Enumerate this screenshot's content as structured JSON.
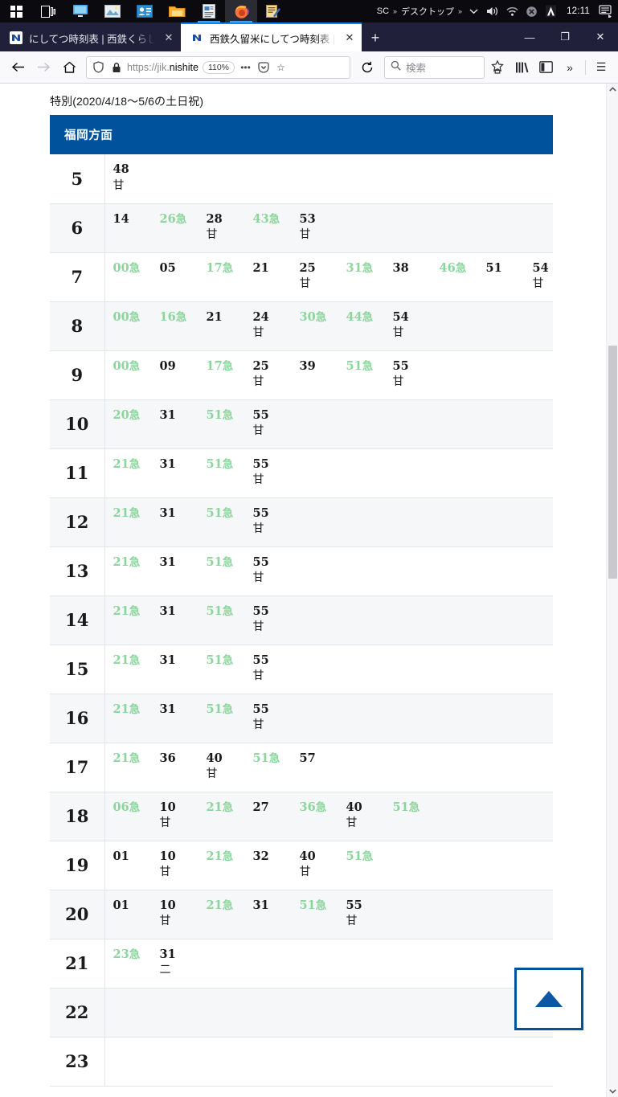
{
  "taskbar": {
    "icons": [
      {
        "name": "windows-start-icon",
        "glyph": "start"
      },
      {
        "name": "task-view-icon",
        "glyph": "taskview"
      },
      {
        "name": "remote-desktop-icon",
        "glyph": "monitor"
      },
      {
        "name": "photos-icon",
        "glyph": "photo"
      },
      {
        "name": "contacts-icon",
        "glyph": "contact"
      },
      {
        "name": "file-explorer-icon",
        "glyph": "folder"
      },
      {
        "name": "text-editor-icon",
        "glyph": "doc"
      },
      {
        "name": "firefox-icon",
        "glyph": "firefox"
      },
      {
        "name": "notepad-editor-icon",
        "glyph": "editor"
      }
    ],
    "ime_label": "SC",
    "ime_chevron": "»",
    "desktop_label": "デスクトップ",
    "desktop_chevron": "»",
    "show_hidden": "∨",
    "volume_icon": "🔊",
    "network_icon": "network-icon",
    "block_icon": "⊗",
    "app_icon": "A",
    "clock": "12:11",
    "notification_icon": "notification-icon"
  },
  "browser": {
    "tabs": [
      {
        "favicon": "N",
        "title": "にしてつ時刻表 | 西鉄くらしネット",
        "close": "✕",
        "active": false
      },
      {
        "favicon": "N",
        "title": "西鉄久留米にしてつ時刻表 | 西鉄",
        "close": "✕",
        "active": true
      }
    ],
    "new_tab_label": "+",
    "window_controls": {
      "minimize": "—",
      "maximize": "❐",
      "close": "✕"
    },
    "nav": {
      "back": "←",
      "forward": "→",
      "home": "⌂",
      "reload": "↻"
    },
    "url": {
      "shield_icon": "shield-icon",
      "lock_icon": "🔒",
      "protocol": "https://jik.",
      "domain": "nishite",
      "zoom_level": "110%",
      "page_actions": "•••",
      "pocket_icon": "pocket-icon",
      "bookmark_icon": "☆"
    },
    "search": {
      "icon": "search-icon",
      "placeholder": "検索",
      "value": ""
    },
    "toolbar_right": {
      "screenshot": "screenshot-icon",
      "library": "library-icon",
      "sidebar": "sidebar-icon",
      "overflow": "»",
      "menu": "☰"
    }
  },
  "page": {
    "caption": "特別(2020/4/18〜5/6の土日祝)",
    "table_header": "福岡方面",
    "scroll_top_button": "scroll-to-top",
    "rows": [
      {
        "hour": "5",
        "slots": [
          {
            "m": "48",
            "sfx": "",
            "sub": "甘",
            "exp": false
          }
        ]
      },
      {
        "hour": "6",
        "slots": [
          {
            "m": "14",
            "sfx": "",
            "sub": "",
            "exp": false
          },
          {
            "m": "26",
            "sfx": "急",
            "sub": "",
            "exp": true
          },
          {
            "m": "28",
            "sfx": "",
            "sub": "甘",
            "exp": false
          },
          {
            "m": "43",
            "sfx": "急",
            "sub": "",
            "exp": true
          },
          {
            "m": "53",
            "sfx": "",
            "sub": "甘",
            "exp": false
          }
        ]
      },
      {
        "hour": "7",
        "slots": [
          {
            "m": "00",
            "sfx": "急",
            "sub": "",
            "exp": true
          },
          {
            "m": "05",
            "sfx": "",
            "sub": "",
            "exp": false
          },
          {
            "m": "17",
            "sfx": "急",
            "sub": "",
            "exp": true
          },
          {
            "m": "21",
            "sfx": "",
            "sub": "",
            "exp": false
          },
          {
            "m": "25",
            "sfx": "",
            "sub": "甘",
            "exp": false
          },
          {
            "m": "31",
            "sfx": "急",
            "sub": "",
            "exp": true
          },
          {
            "m": "38",
            "sfx": "",
            "sub": "",
            "exp": false
          },
          {
            "m": "46",
            "sfx": "急",
            "sub": "",
            "exp": true
          },
          {
            "m": "51",
            "sfx": "",
            "sub": "",
            "exp": false
          },
          {
            "m": "54",
            "sfx": "",
            "sub": "甘",
            "exp": false
          }
        ]
      },
      {
        "hour": "8",
        "slots": [
          {
            "m": "00",
            "sfx": "急",
            "sub": "",
            "exp": true
          },
          {
            "m": "16",
            "sfx": "急",
            "sub": "",
            "exp": true
          },
          {
            "m": "21",
            "sfx": "",
            "sub": "",
            "exp": false
          },
          {
            "m": "24",
            "sfx": "",
            "sub": "甘",
            "exp": false
          },
          {
            "m": "30",
            "sfx": "急",
            "sub": "",
            "exp": true
          },
          {
            "m": "44",
            "sfx": "急",
            "sub": "",
            "exp": true
          },
          {
            "m": "54",
            "sfx": "",
            "sub": "甘",
            "exp": false
          }
        ]
      },
      {
        "hour": "9",
        "slots": [
          {
            "m": "00",
            "sfx": "急",
            "sub": "",
            "exp": true
          },
          {
            "m": "09",
            "sfx": "",
            "sub": "",
            "exp": false
          },
          {
            "m": "17",
            "sfx": "急",
            "sub": "",
            "exp": true
          },
          {
            "m": "25",
            "sfx": "",
            "sub": "甘",
            "exp": false
          },
          {
            "m": "39",
            "sfx": "",
            "sub": "",
            "exp": false
          },
          {
            "m": "51",
            "sfx": "急",
            "sub": "",
            "exp": true
          },
          {
            "m": "55",
            "sfx": "",
            "sub": "甘",
            "exp": false
          }
        ]
      },
      {
        "hour": "10",
        "slots": [
          {
            "m": "20",
            "sfx": "急",
            "sub": "",
            "exp": true
          },
          {
            "m": "31",
            "sfx": "",
            "sub": "",
            "exp": false
          },
          {
            "m": "51",
            "sfx": "急",
            "sub": "",
            "exp": true
          },
          {
            "m": "55",
            "sfx": "",
            "sub": "甘",
            "exp": false
          }
        ]
      },
      {
        "hour": "11",
        "slots": [
          {
            "m": "21",
            "sfx": "急",
            "sub": "",
            "exp": true
          },
          {
            "m": "31",
            "sfx": "",
            "sub": "",
            "exp": false
          },
          {
            "m": "51",
            "sfx": "急",
            "sub": "",
            "exp": true
          },
          {
            "m": "55",
            "sfx": "",
            "sub": "甘",
            "exp": false
          }
        ]
      },
      {
        "hour": "12",
        "slots": [
          {
            "m": "21",
            "sfx": "急",
            "sub": "",
            "exp": true
          },
          {
            "m": "31",
            "sfx": "",
            "sub": "",
            "exp": false
          },
          {
            "m": "51",
            "sfx": "急",
            "sub": "",
            "exp": true
          },
          {
            "m": "55",
            "sfx": "",
            "sub": "甘",
            "exp": false
          }
        ]
      },
      {
        "hour": "13",
        "slots": [
          {
            "m": "21",
            "sfx": "急",
            "sub": "",
            "exp": true
          },
          {
            "m": "31",
            "sfx": "",
            "sub": "",
            "exp": false
          },
          {
            "m": "51",
            "sfx": "急",
            "sub": "",
            "exp": true
          },
          {
            "m": "55",
            "sfx": "",
            "sub": "甘",
            "exp": false
          }
        ]
      },
      {
        "hour": "14",
        "slots": [
          {
            "m": "21",
            "sfx": "急",
            "sub": "",
            "exp": true
          },
          {
            "m": "31",
            "sfx": "",
            "sub": "",
            "exp": false
          },
          {
            "m": "51",
            "sfx": "急",
            "sub": "",
            "exp": true
          },
          {
            "m": "55",
            "sfx": "",
            "sub": "甘",
            "exp": false
          }
        ]
      },
      {
        "hour": "15",
        "slots": [
          {
            "m": "21",
            "sfx": "急",
            "sub": "",
            "exp": true
          },
          {
            "m": "31",
            "sfx": "",
            "sub": "",
            "exp": false
          },
          {
            "m": "51",
            "sfx": "急",
            "sub": "",
            "exp": true
          },
          {
            "m": "55",
            "sfx": "",
            "sub": "甘",
            "exp": false
          }
        ]
      },
      {
        "hour": "16",
        "slots": [
          {
            "m": "21",
            "sfx": "急",
            "sub": "",
            "exp": true
          },
          {
            "m": "31",
            "sfx": "",
            "sub": "",
            "exp": false
          },
          {
            "m": "51",
            "sfx": "急",
            "sub": "",
            "exp": true
          },
          {
            "m": "55",
            "sfx": "",
            "sub": "甘",
            "exp": false
          }
        ]
      },
      {
        "hour": "17",
        "slots": [
          {
            "m": "21",
            "sfx": "急",
            "sub": "",
            "exp": true
          },
          {
            "m": "36",
            "sfx": "",
            "sub": "",
            "exp": false
          },
          {
            "m": "40",
            "sfx": "",
            "sub": "甘",
            "exp": false
          },
          {
            "m": "51",
            "sfx": "急",
            "sub": "",
            "exp": true
          },
          {
            "m": "57",
            "sfx": "",
            "sub": "",
            "exp": false
          }
        ]
      },
      {
        "hour": "18",
        "slots": [
          {
            "m": "06",
            "sfx": "急",
            "sub": "",
            "exp": true
          },
          {
            "m": "10",
            "sfx": "",
            "sub": "甘",
            "exp": false
          },
          {
            "m": "21",
            "sfx": "急",
            "sub": "",
            "exp": true
          },
          {
            "m": "27",
            "sfx": "",
            "sub": "",
            "exp": false
          },
          {
            "m": "36",
            "sfx": "急",
            "sub": "",
            "exp": true
          },
          {
            "m": "40",
            "sfx": "",
            "sub": "甘",
            "exp": false
          },
          {
            "m": "51",
            "sfx": "急",
            "sub": "",
            "exp": true
          }
        ]
      },
      {
        "hour": "19",
        "slots": [
          {
            "m": "01",
            "sfx": "",
            "sub": "",
            "exp": false
          },
          {
            "m": "10",
            "sfx": "",
            "sub": "甘",
            "exp": false
          },
          {
            "m": "21",
            "sfx": "急",
            "sub": "",
            "exp": true
          },
          {
            "m": "32",
            "sfx": "",
            "sub": "",
            "exp": false
          },
          {
            "m": "40",
            "sfx": "",
            "sub": "甘",
            "exp": false
          },
          {
            "m": "51",
            "sfx": "急",
            "sub": "",
            "exp": true
          }
        ]
      },
      {
        "hour": "20",
        "slots": [
          {
            "m": "01",
            "sfx": "",
            "sub": "",
            "exp": false
          },
          {
            "m": "10",
            "sfx": "",
            "sub": "甘",
            "exp": false
          },
          {
            "m": "21",
            "sfx": "急",
            "sub": "",
            "exp": true
          },
          {
            "m": "31",
            "sfx": "",
            "sub": "",
            "exp": false
          },
          {
            "m": "51",
            "sfx": "急",
            "sub": "",
            "exp": true
          },
          {
            "m": "55",
            "sfx": "",
            "sub": "甘",
            "exp": false
          }
        ]
      },
      {
        "hour": "21",
        "slots": [
          {
            "m": "23",
            "sfx": "急",
            "sub": "",
            "exp": true
          },
          {
            "m": "31",
            "sfx": "",
            "sub": "二",
            "exp": false
          }
        ]
      },
      {
        "hour": "22",
        "slots": []
      },
      {
        "hour": "23",
        "slots": []
      }
    ]
  },
  "colors": {
    "header_blue": "#00529c",
    "express_green": "#8bd69c",
    "row_alt": "#f5f7f8",
    "tab_active_accent": "#0a84ff"
  }
}
